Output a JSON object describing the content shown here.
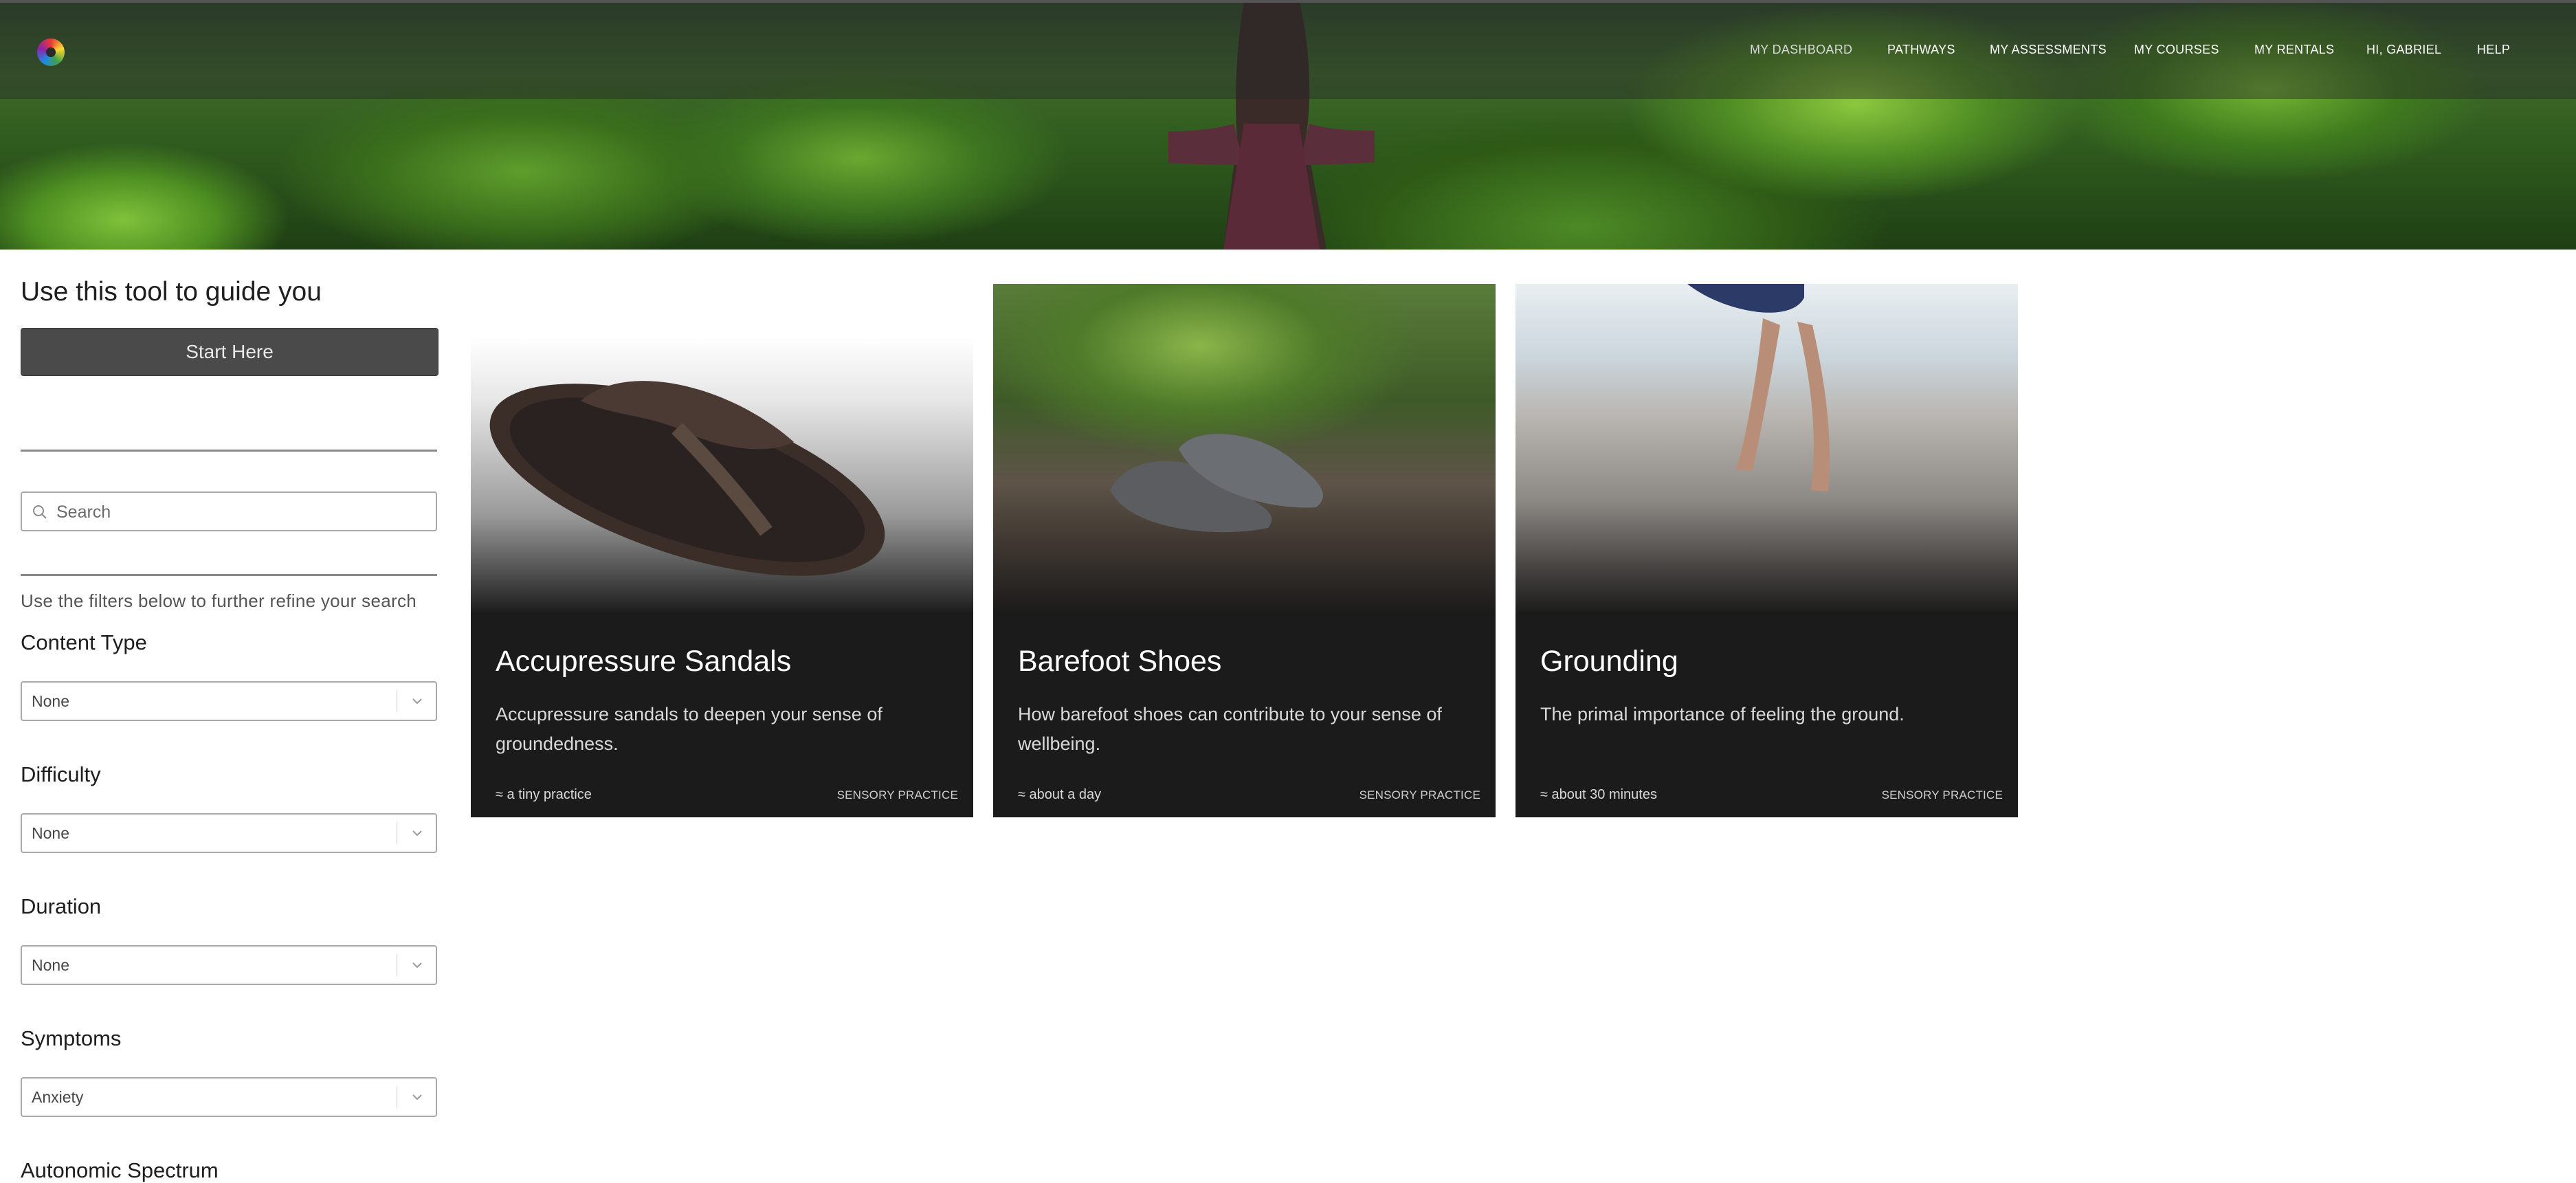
{
  "nav": {
    "items": [
      "MY DASHBOARD",
      "PATHWAYS",
      "MY ASSESSMENTS",
      "MY COURSES",
      "MY RENTALS",
      "HI, GABRIEL",
      "HELP"
    ]
  },
  "sidebar": {
    "guide_title": "Use this tool to guide you",
    "start_button": "Start Here",
    "search_placeholder": "Search",
    "filters_hint": "Use the filters below to further refine your search",
    "filters": [
      {
        "label": "Content Type",
        "value": "None"
      },
      {
        "label": "Difficulty",
        "value": "None"
      },
      {
        "label": "Duration",
        "value": "None"
      },
      {
        "label": "Symptoms",
        "value": "Anxiety"
      },
      {
        "label": "Autonomic Spectrum"
      }
    ]
  },
  "cards": [
    {
      "title": "Accupressure Sandals",
      "description": "Accupressure sandals to deepen your sense of groundedness.",
      "duration": "≈ a tiny practice",
      "type": "SENSORY PRACTICE"
    },
    {
      "title": "Barefoot Shoes",
      "description": "How barefoot shoes can contribute to your sense of wellbeing.",
      "duration": "≈ about a day",
      "type": "SENSORY PRACTICE"
    },
    {
      "title": "Grounding",
      "description": "The primal importance of feeling the ground.",
      "duration": "≈ about 30 minutes",
      "type": "SENSORY PRACTICE"
    }
  ]
}
